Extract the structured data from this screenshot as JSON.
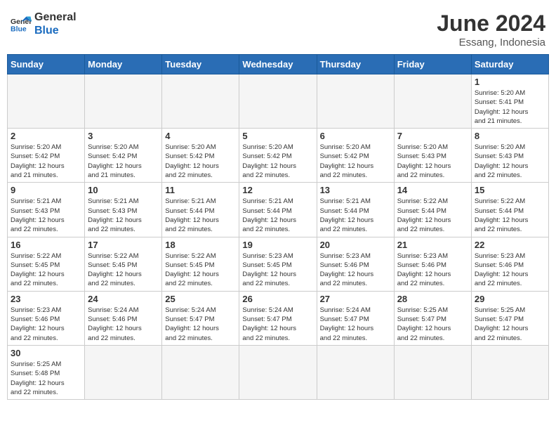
{
  "logo": {
    "general": "General",
    "blue": "Blue"
  },
  "header": {
    "month": "June 2024",
    "location": "Essang, Indonesia"
  },
  "days_of_week": [
    "Sunday",
    "Monday",
    "Tuesday",
    "Wednesday",
    "Thursday",
    "Friday",
    "Saturday"
  ],
  "weeks": [
    [
      {
        "day": "",
        "empty": true
      },
      {
        "day": "",
        "empty": true
      },
      {
        "day": "",
        "empty": true
      },
      {
        "day": "",
        "empty": true
      },
      {
        "day": "",
        "empty": true
      },
      {
        "day": "",
        "empty": true
      },
      {
        "day": "1",
        "sunrise": "5:20 AM",
        "sunset": "5:41 PM",
        "daylight": "12 hours and 21 minutes."
      }
    ],
    [
      {
        "day": "2",
        "sunrise": "5:20 AM",
        "sunset": "5:42 PM",
        "daylight": "12 hours and 21 minutes."
      },
      {
        "day": "3",
        "sunrise": "5:20 AM",
        "sunset": "5:42 PM",
        "daylight": "12 hours and 21 minutes."
      },
      {
        "day": "4",
        "sunrise": "5:20 AM",
        "sunset": "5:42 PM",
        "daylight": "12 hours and 22 minutes."
      },
      {
        "day": "5",
        "sunrise": "5:20 AM",
        "sunset": "5:42 PM",
        "daylight": "12 hours and 22 minutes."
      },
      {
        "day": "6",
        "sunrise": "5:20 AM",
        "sunset": "5:42 PM",
        "daylight": "12 hours and 22 minutes."
      },
      {
        "day": "7",
        "sunrise": "5:20 AM",
        "sunset": "5:43 PM",
        "daylight": "12 hours and 22 minutes."
      },
      {
        "day": "8",
        "sunrise": "5:20 AM",
        "sunset": "5:43 PM",
        "daylight": "12 hours and 22 minutes."
      }
    ],
    [
      {
        "day": "9",
        "sunrise": "5:21 AM",
        "sunset": "5:43 PM",
        "daylight": "12 hours and 22 minutes."
      },
      {
        "day": "10",
        "sunrise": "5:21 AM",
        "sunset": "5:43 PM",
        "daylight": "12 hours and 22 minutes."
      },
      {
        "day": "11",
        "sunrise": "5:21 AM",
        "sunset": "5:44 PM",
        "daylight": "12 hours and 22 minutes."
      },
      {
        "day": "12",
        "sunrise": "5:21 AM",
        "sunset": "5:44 PM",
        "daylight": "12 hours and 22 minutes."
      },
      {
        "day": "13",
        "sunrise": "5:21 AM",
        "sunset": "5:44 PM",
        "daylight": "12 hours and 22 minutes."
      },
      {
        "day": "14",
        "sunrise": "5:22 AM",
        "sunset": "5:44 PM",
        "daylight": "12 hours and 22 minutes."
      },
      {
        "day": "15",
        "sunrise": "5:22 AM",
        "sunset": "5:44 PM",
        "daylight": "12 hours and 22 minutes."
      }
    ],
    [
      {
        "day": "16",
        "sunrise": "5:22 AM",
        "sunset": "5:45 PM",
        "daylight": "12 hours and 22 minutes."
      },
      {
        "day": "17",
        "sunrise": "5:22 AM",
        "sunset": "5:45 PM",
        "daylight": "12 hours and 22 minutes."
      },
      {
        "day": "18",
        "sunrise": "5:22 AM",
        "sunset": "5:45 PM",
        "daylight": "12 hours and 22 minutes."
      },
      {
        "day": "19",
        "sunrise": "5:23 AM",
        "sunset": "5:45 PM",
        "daylight": "12 hours and 22 minutes."
      },
      {
        "day": "20",
        "sunrise": "5:23 AM",
        "sunset": "5:46 PM",
        "daylight": "12 hours and 22 minutes."
      },
      {
        "day": "21",
        "sunrise": "5:23 AM",
        "sunset": "5:46 PM",
        "daylight": "12 hours and 22 minutes."
      },
      {
        "day": "22",
        "sunrise": "5:23 AM",
        "sunset": "5:46 PM",
        "daylight": "12 hours and 22 minutes."
      }
    ],
    [
      {
        "day": "23",
        "sunrise": "5:23 AM",
        "sunset": "5:46 PM",
        "daylight": "12 hours and 22 minutes."
      },
      {
        "day": "24",
        "sunrise": "5:24 AM",
        "sunset": "5:46 PM",
        "daylight": "12 hours and 22 minutes."
      },
      {
        "day": "25",
        "sunrise": "5:24 AM",
        "sunset": "5:47 PM",
        "daylight": "12 hours and 22 minutes."
      },
      {
        "day": "26",
        "sunrise": "5:24 AM",
        "sunset": "5:47 PM",
        "daylight": "12 hours and 22 minutes."
      },
      {
        "day": "27",
        "sunrise": "5:24 AM",
        "sunset": "5:47 PM",
        "daylight": "12 hours and 22 minutes."
      },
      {
        "day": "28",
        "sunrise": "5:25 AM",
        "sunset": "5:47 PM",
        "daylight": "12 hours and 22 minutes."
      },
      {
        "day": "29",
        "sunrise": "5:25 AM",
        "sunset": "5:47 PM",
        "daylight": "12 hours and 22 minutes."
      }
    ],
    [
      {
        "day": "30",
        "sunrise": "5:25 AM",
        "sunset": "5:48 PM",
        "daylight": "12 hours and 22 minutes."
      },
      {
        "day": "",
        "empty": true
      },
      {
        "day": "",
        "empty": true
      },
      {
        "day": "",
        "empty": true
      },
      {
        "day": "",
        "empty": true
      },
      {
        "day": "",
        "empty": true
      },
      {
        "day": "",
        "empty": true
      }
    ]
  ],
  "labels": {
    "sunrise": "Sunrise: ",
    "sunset": "Sunset: ",
    "daylight": "Daylight: "
  }
}
